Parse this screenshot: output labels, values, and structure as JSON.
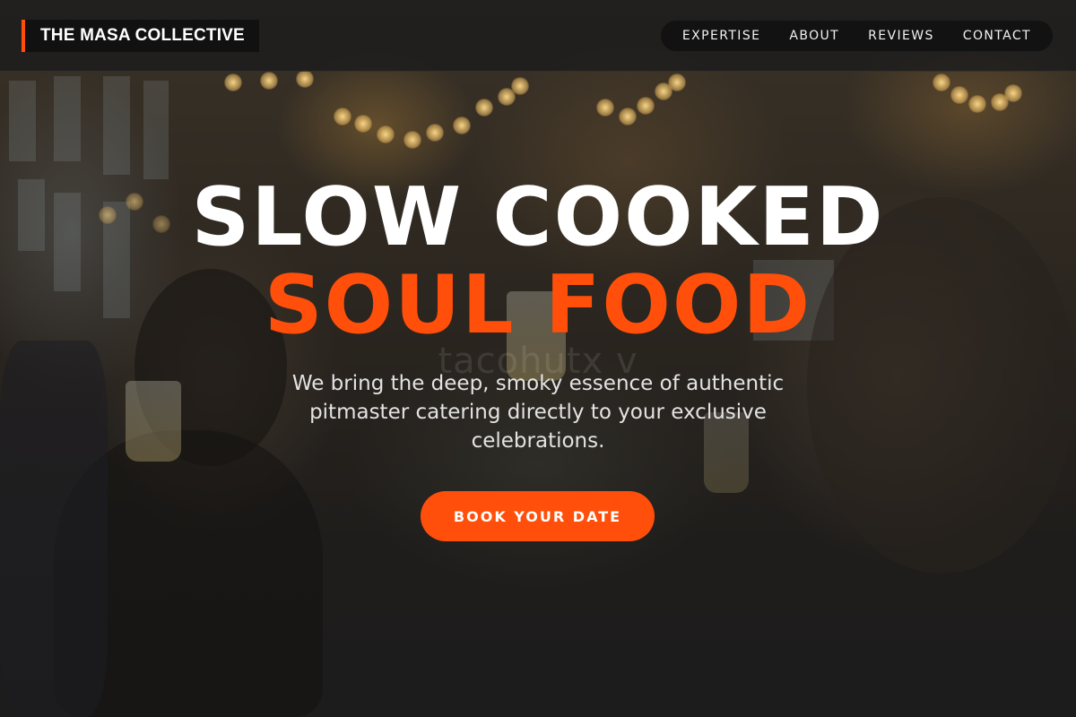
{
  "header": {
    "brand": "THE MASA COLLECTIVE",
    "nav": [
      "EXPERTISE",
      "ABOUT",
      "REVIEWS",
      "CONTACT"
    ]
  },
  "hero": {
    "headline_line1": "SLOW COOKED",
    "headline_line2": "SOUL FOOD",
    "background_watermark": "tacohutx v",
    "subtitle": "We bring the deep, smoky essence of authentic pitmaster catering directly to your exclusive celebrations.",
    "cta_label": "BOOK YOUR DATE",
    "background_image": "blurred photo of guests raising champagne glasses at an event under string lights"
  },
  "colors": {
    "accent": "#ff4f0a",
    "header_bg": "#1c1c1c",
    "text_primary": "#ffffff",
    "text_secondary": "#e3e3e3"
  }
}
